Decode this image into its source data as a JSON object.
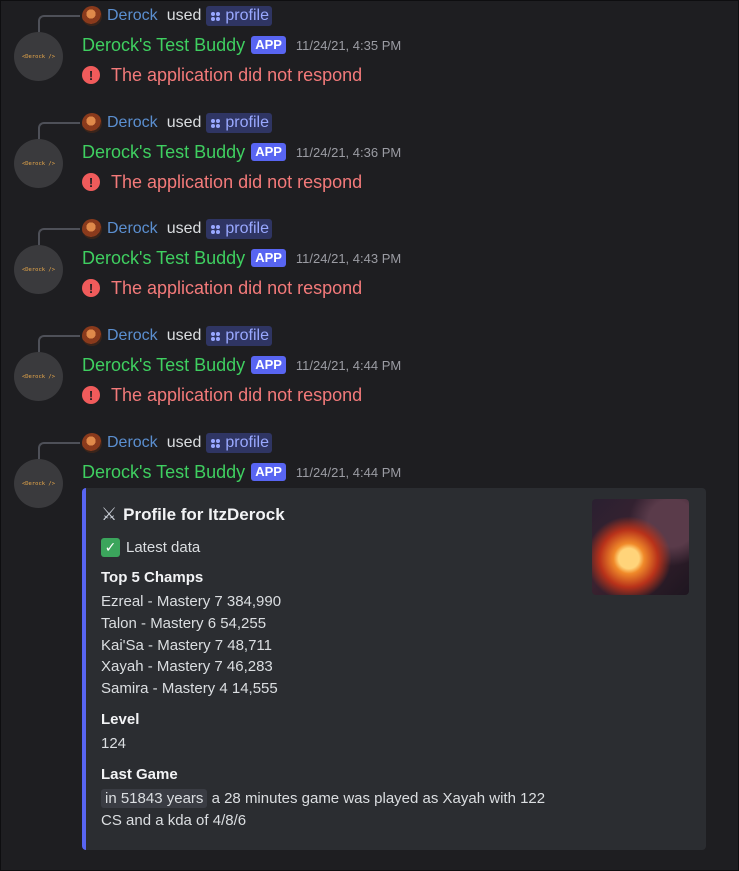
{
  "messages": [
    {
      "reply": {
        "user": "Derock",
        "used": "used",
        "command": "profile"
      },
      "bot": {
        "name": "Derock's Test Buddy",
        "badge": "APP",
        "time": "11/24/21, 4:35 PM",
        "avatar_text": "<Derock />"
      },
      "error": "The application did not respond"
    },
    {
      "reply": {
        "user": "Derock",
        "used": "used",
        "command": "profile"
      },
      "bot": {
        "name": "Derock's Test Buddy",
        "badge": "APP",
        "time": "11/24/21, 4:36 PM",
        "avatar_text": "<Derock />"
      },
      "error": "The application did not respond"
    },
    {
      "reply": {
        "user": "Derock",
        "used": "used",
        "command": "profile"
      },
      "bot": {
        "name": "Derock's Test Buddy",
        "badge": "APP",
        "time": "11/24/21, 4:43 PM",
        "avatar_text": "<Derock />"
      },
      "error": "The application did not respond"
    },
    {
      "reply": {
        "user": "Derock",
        "used": "used",
        "command": "profile"
      },
      "bot": {
        "name": "Derock's Test Buddy",
        "badge": "APP",
        "time": "11/24/21, 4:44 PM",
        "avatar_text": "<Derock />"
      },
      "error": "The application did not respond"
    },
    {
      "reply": {
        "user": "Derock",
        "used": "used",
        "command": "profile"
      },
      "bot": {
        "name": "Derock's Test Buddy",
        "badge": "APP",
        "time": "11/24/21, 4:44 PM",
        "avatar_text": "<Derock />"
      }
    }
  ],
  "embed": {
    "title": "Profile for ItzDerock",
    "status": "Latest data",
    "champs_title": "Top 5 Champs",
    "champs": [
      "Ezreal - Mastery 7 384,990",
      "Talon - Mastery 6 54,255",
      "Kai'Sa - Mastery 7 48,711",
      "Xayah - Mastery 7 46,283",
      "Samira - Mastery 4 14,555"
    ],
    "level_title": "Level",
    "level": "124",
    "last_game_title": "Last Game",
    "last_game_time": "in 51843 years",
    "last_game_line1": "a 28 minutes game was played as Xayah with 122",
    "last_game_line2": "CS and a kda of 4/8/6"
  },
  "icons": {
    "error": "error-circle-icon",
    "command": "command-dots-icon",
    "title": "crossed-swords-icon",
    "status": "check-mark-icon"
  },
  "colors": {
    "background": "#1e1e21",
    "bot_name": "#3fcf60",
    "app_badge": "#5865f2",
    "error": "#f47a7a",
    "user_link": "#5b8fd0",
    "embed_accent": "#5865f2"
  }
}
